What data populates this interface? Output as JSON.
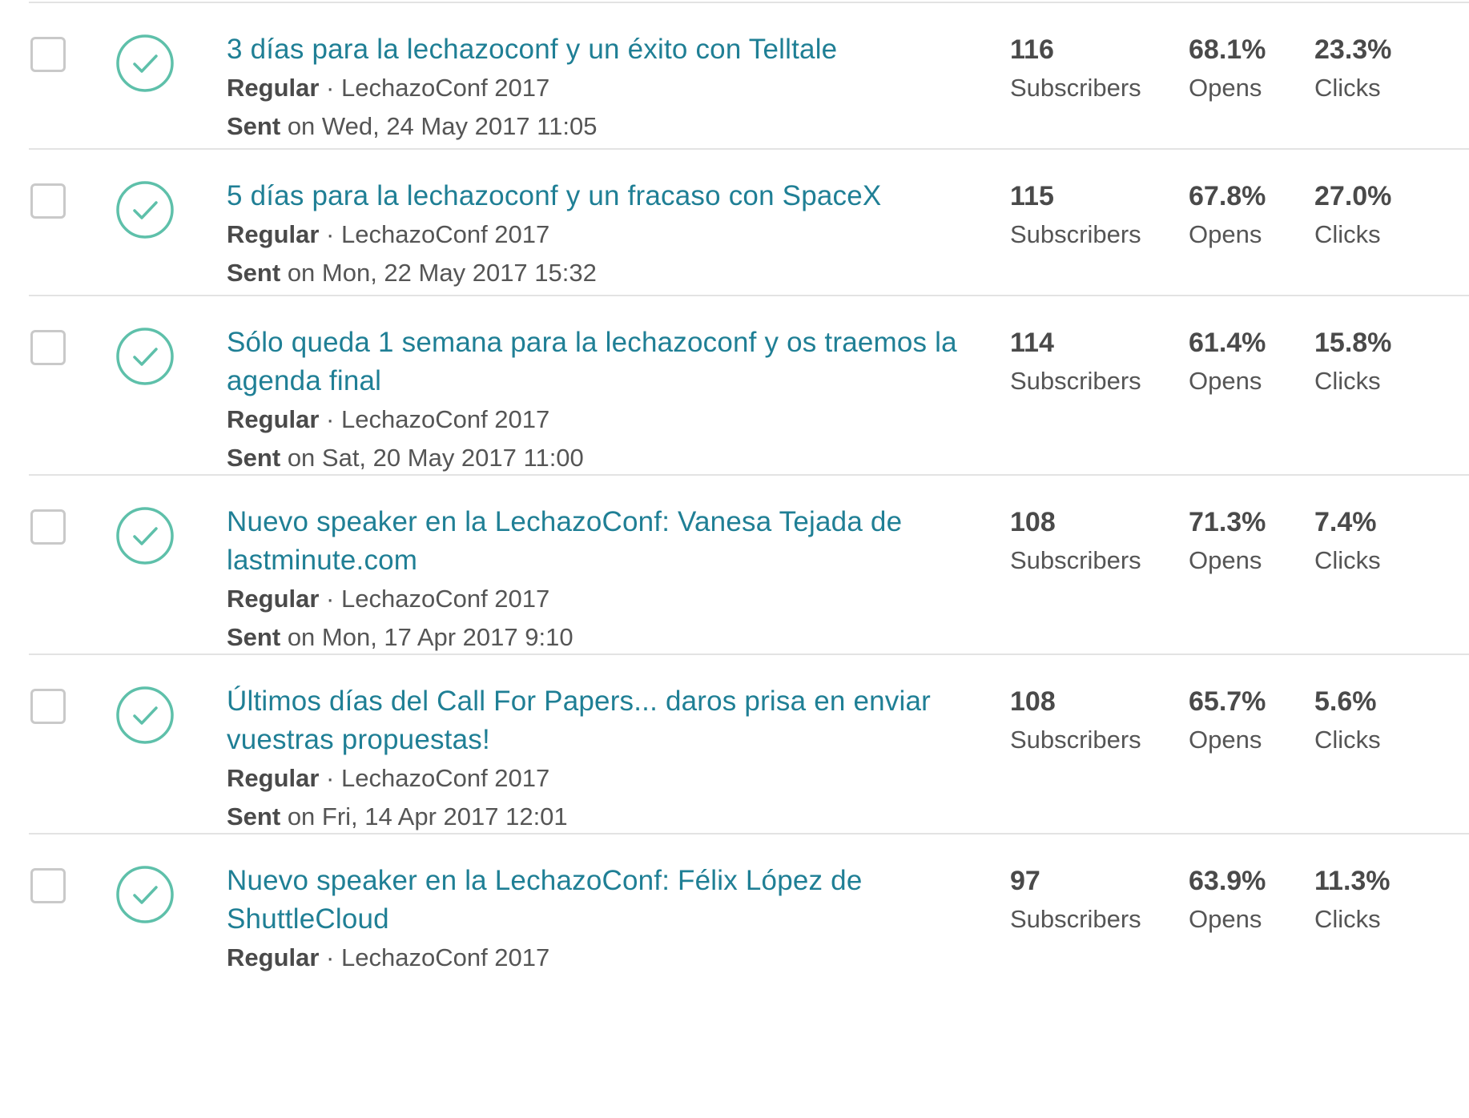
{
  "campaigns": [
    {
      "title": "3 días para la lechazoconf y un éxito con Telltale",
      "type": "Regular",
      "list": "LechazoConf 2017",
      "sent_label": "Sent",
      "sent_on": "on Wed, 24 May 2017 11:05",
      "subscribers": "116",
      "subscribers_label": "Subscribers",
      "opens": "68.1%",
      "opens_label": "Opens",
      "clicks": "23.3%",
      "clicks_label": "Clicks"
    },
    {
      "title": "5 días para la lechazoconf y un fracaso con SpaceX",
      "type": "Regular",
      "list": "LechazoConf 2017",
      "sent_label": "Sent",
      "sent_on": "on Mon, 22 May 2017 15:32",
      "subscribers": "115",
      "subscribers_label": "Subscribers",
      "opens": "67.8%",
      "opens_label": "Opens",
      "clicks": "27.0%",
      "clicks_label": "Clicks"
    },
    {
      "title": "Sólo queda 1 semana para la lechazoconf y os traemos la agenda final",
      "type": "Regular",
      "list": "LechazoConf 2017",
      "sent_label": "Sent",
      "sent_on": "on Sat, 20 May 2017 11:00",
      "subscribers": "114",
      "subscribers_label": "Subscribers",
      "opens": "61.4%",
      "opens_label": "Opens",
      "clicks": "15.8%",
      "clicks_label": "Clicks"
    },
    {
      "title": "Nuevo speaker en la LechazoConf: Vanesa Tejada de lastminute.com",
      "type": "Regular",
      "list": "LechazoConf 2017",
      "sent_label": "Sent",
      "sent_on": "on Mon, 17 Apr 2017 9:10",
      "subscribers": "108",
      "subscribers_label": "Subscribers",
      "opens": "71.3%",
      "opens_label": "Opens",
      "clicks": "7.4%",
      "clicks_label": "Clicks"
    },
    {
      "title": "Últimos días del Call For Papers... daros prisa en enviar vuestras propuestas!",
      "type": "Regular",
      "list": "LechazoConf 2017",
      "sent_label": "Sent",
      "sent_on": "on Fri, 14 Apr 2017 12:01",
      "subscribers": "108",
      "subscribers_label": "Subscribers",
      "opens": "65.7%",
      "opens_label": "Opens",
      "clicks": "5.6%",
      "clicks_label": "Clicks"
    },
    {
      "title": "Nuevo speaker en la LechazoConf: Félix López de ShuttleCloud",
      "type": "Regular",
      "list": "LechazoConf 2017",
      "sent_label": "",
      "sent_on": "",
      "subscribers": "97",
      "subscribers_label": "Subscribers",
      "opens": "63.9%",
      "opens_label": "Opens",
      "clicks": "11.3%",
      "clicks_label": "Clicks"
    }
  ],
  "meta_separator": "·",
  "colors": {
    "title_link": "#1f7f95",
    "status_check": "#5ec0aa",
    "divider": "#e3e3e3",
    "checkbox_border": "#c9c9c9"
  },
  "icons": {
    "status": "check-circle-icon"
  }
}
